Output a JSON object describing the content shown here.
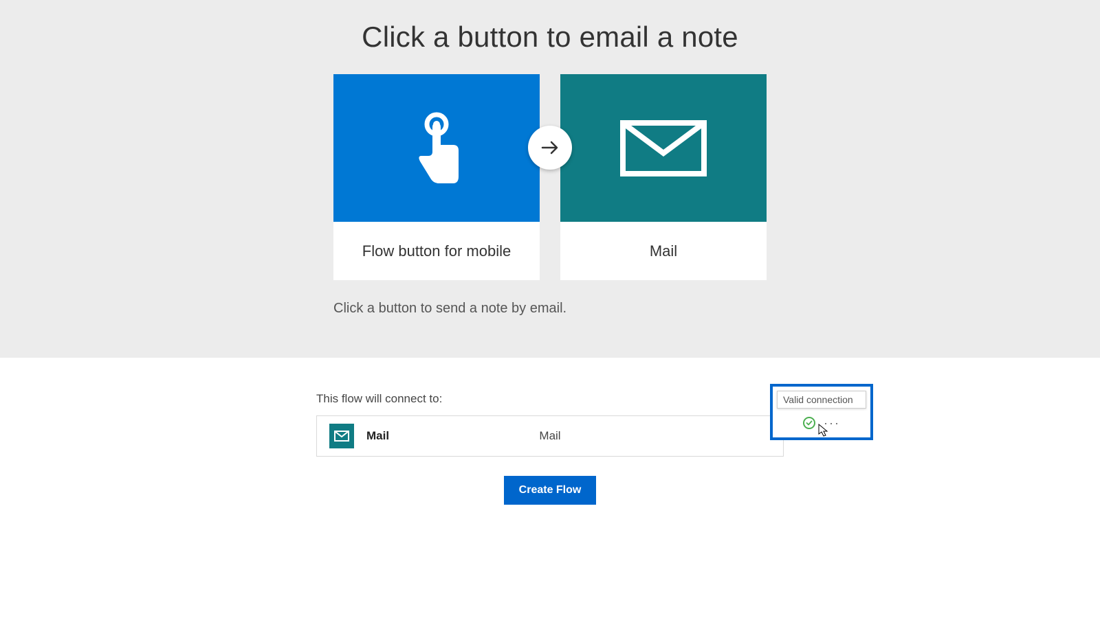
{
  "header": {
    "title": "Click a button to email a note"
  },
  "tiles": {
    "left_label": "Flow button for mobile",
    "right_label": "Mail"
  },
  "description": "Click a button to send a note by email.",
  "connection": {
    "section_label": "This flow will connect to:",
    "service_name": "Mail",
    "service_type": "Mail"
  },
  "actions": {
    "create_flow_label": "Create Flow"
  },
  "callout": {
    "tooltip_text": "Valid connection"
  },
  "colors": {
    "tile_blue": "#0078d4",
    "tile_teal": "#107c84",
    "primary_button": "#0066cc",
    "success_green": "#4caf50"
  }
}
